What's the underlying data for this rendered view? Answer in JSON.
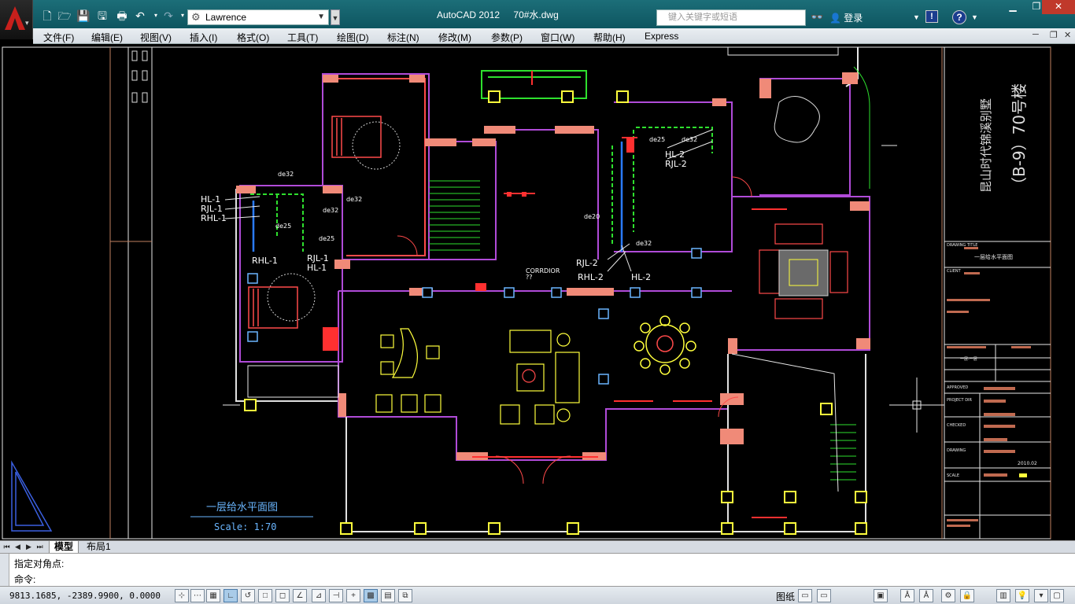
{
  "titlebar": {
    "app": "AutoCAD 2012",
    "file": "70#水.dwg",
    "workspace": "Lawrence",
    "search_placeholder": "键入关键字或短语",
    "login": "登录"
  },
  "menu": [
    "文件(F)",
    "编辑(E)",
    "视图(V)",
    "插入(I)",
    "格式(O)",
    "工具(T)",
    "绘图(D)",
    "标注(N)",
    "修改(M)",
    "参数(P)",
    "窗口(W)",
    "帮助(H)",
    "Express"
  ],
  "drawing": {
    "plan_title": "一层给水平面图",
    "scale": "Scale: 1:70",
    "corridor_label": "CORRDIOR",
    "corridor_sub": "??",
    "side_title_1": "昆山时代锦溪别墅",
    "side_title_2": "（B-9）70号楼",
    "drawing_title_label": "DRAWING TITLE",
    "drawing_title_value": "一层给水平面图",
    "client_label": "CLIENT",
    "approved_label": "APPROVED",
    "project_dir_label": "PROJECT DIR",
    "checked_label": "CHECKED",
    "drawing_label": "DRAWING",
    "scale_label": "SCALE",
    "date_value": "2010.02",
    "sheet_code": "一层-一层",
    "pipe_labels": [
      "HL-1",
      "RJL-1",
      "RHL-1",
      "RHL-1",
      "RJL-1",
      "HL-1",
      "RJL-2",
      "RHL-2",
      "HL-2",
      "HL-2",
      "RJL-2",
      "de32",
      "de25",
      "de32",
      "de25",
      "de32",
      "de20",
      "de25",
      "de32",
      "de32"
    ]
  },
  "layout_tabs": {
    "model": "模型",
    "layout1": "布局1"
  },
  "command": {
    "line1": "指定对角点:",
    "line2": "命令:"
  },
  "status": {
    "coords": "9813.1685, -2389.9900, 0.0000",
    "model": "图纸"
  }
}
